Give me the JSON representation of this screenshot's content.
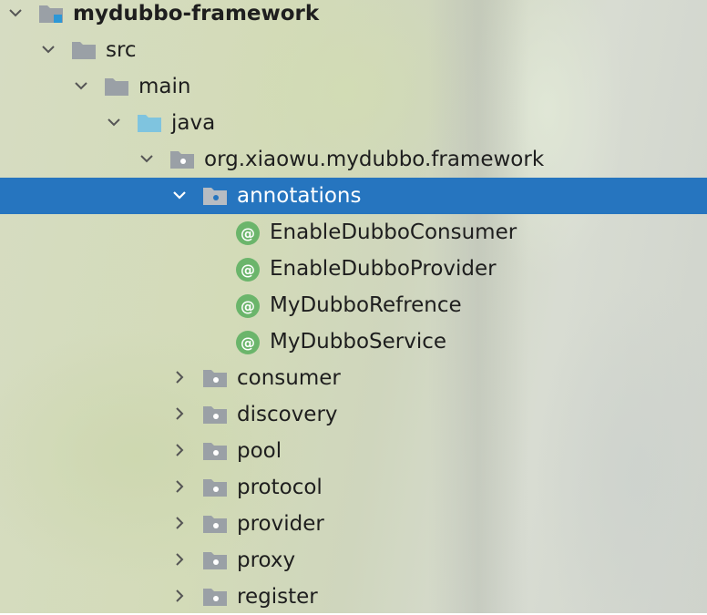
{
  "project_tree": {
    "root": {
      "label": "mydubbo-framework"
    },
    "src": {
      "label": "src"
    },
    "main": {
      "label": "main"
    },
    "java": {
      "label": "java"
    },
    "package": {
      "label": "org.xiaowu.mydubbo.framework"
    },
    "annotations": {
      "label": "annotations",
      "children": [
        {
          "label": "EnableDubboConsumer"
        },
        {
          "label": "EnableDubboProvider"
        },
        {
          "label": "MyDubboRefrence"
        },
        {
          "label": "MyDubboService"
        }
      ]
    },
    "subpackages": [
      {
        "label": "consumer"
      },
      {
        "label": "discovery"
      },
      {
        "label": "pool"
      },
      {
        "label": "protocol"
      },
      {
        "label": "provider"
      },
      {
        "label": "proxy"
      },
      {
        "label": "register"
      }
    ]
  },
  "colors": {
    "selection": "#2675bf",
    "folder_gray": "#9aa0a6",
    "folder_source": "#7fc4df",
    "annotation_icon": "#6bb56b"
  },
  "icons": {
    "expanded": "chevron-down-icon",
    "collapsed": "chevron-right-icon",
    "module": "module-folder-icon",
    "folder": "folder-icon",
    "source_root": "source-root-folder-icon",
    "package": "package-icon",
    "annotation": "annotation-icon"
  }
}
